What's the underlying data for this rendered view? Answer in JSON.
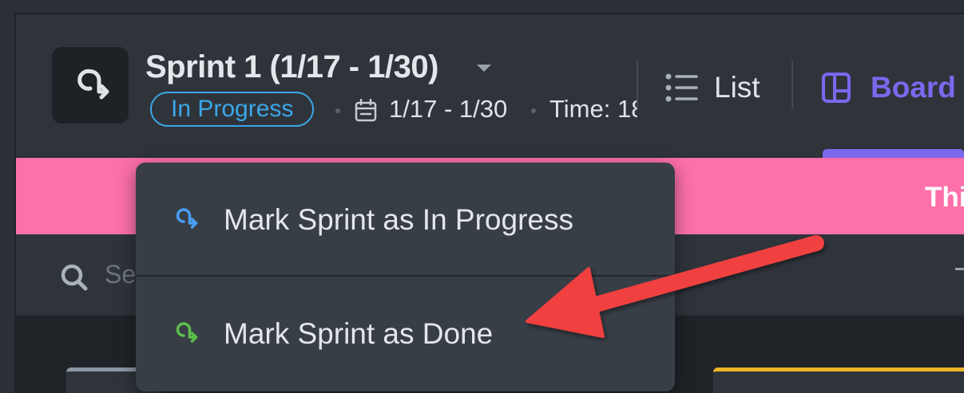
{
  "header": {
    "sprint_title": "Sprint 1 (1/17 - 1/30)",
    "status": "In Progress",
    "dates": "1/17 - 1/30",
    "time": "Time: 18",
    "views": {
      "list_label": "List",
      "board_label": "Board"
    }
  },
  "banner": {
    "text": "Thi"
  },
  "search": {
    "placeholder": "Se"
  },
  "dropdown": {
    "items": [
      {
        "label": "Mark Sprint as In Progress",
        "icon": "sprint-in-progress-icon",
        "icon_color": "#4a9ff5"
      },
      {
        "label": "Mark Sprint as Done",
        "icon": "sprint-done-icon",
        "icon_color": "#5cc04a"
      }
    ]
  },
  "colors": {
    "accent": "#7b68ee",
    "status_in_progress": "#3ba7e8",
    "banner": "#fe70aa",
    "annotation_arrow": "#f04040"
  }
}
